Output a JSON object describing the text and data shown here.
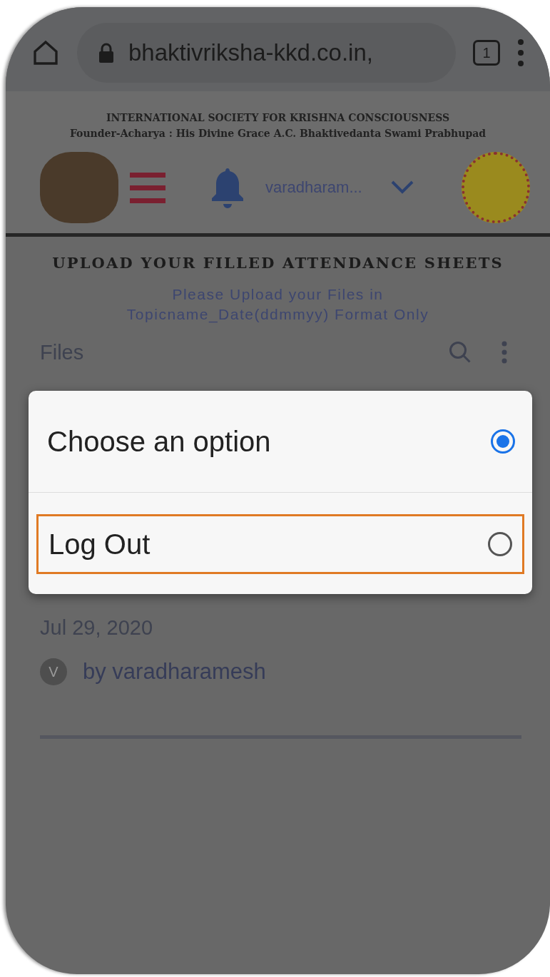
{
  "browser": {
    "url": "bhaktivriksha-kkd.co.in,",
    "tab_count": "1"
  },
  "header": {
    "line_1": "INTERNATIONAL SOCIETY FOR KRISHNA CONSCIOUSNESS",
    "line_2": "Founder-Acharya : His Divine Grace A.C. Bhaktivedanta Swami Prabhupad",
    "username": "varadharam..."
  },
  "page": {
    "title": "UPLOAD YOUR FILLED ATTENDANCE SHEETS",
    "note": [
      "Please Upload your Files in",
      "Topicname_Date(ddmmyy) Format Only"
    ],
    "files_label": "Files",
    "date": "Jul 29, 2020",
    "author_initial": "V",
    "author": "by varadharamesh"
  },
  "dialog": {
    "options": [
      {
        "label": "Choose an option",
        "selected": true,
        "highlighted": false
      },
      {
        "label": "Log Out",
        "selected": false,
        "highlighted": true
      }
    ]
  }
}
